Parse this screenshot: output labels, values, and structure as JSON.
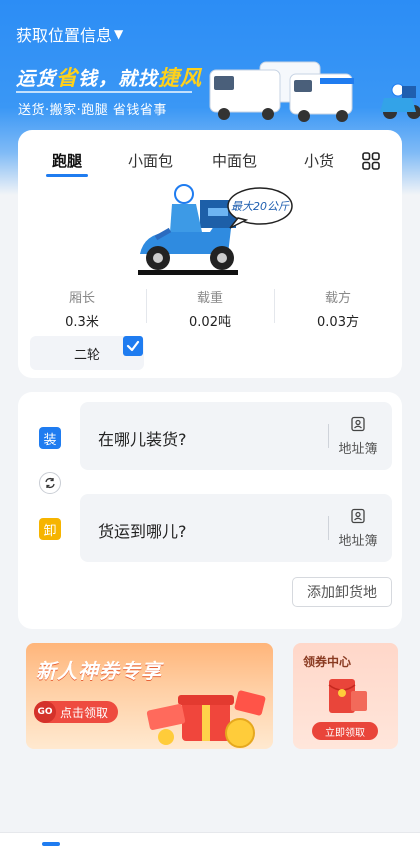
{
  "header": {
    "location_label": "获取位置信息",
    "slogan_parts": [
      "运货",
      "省",
      "钱，就找",
      "捷风"
    ],
    "sub_slogan": "送货·搬家·跑腿  省钱省事",
    "accent_color": "#1f7cf0"
  },
  "vehicle_tabs": [
    {
      "label": "跑腿",
      "active": true
    },
    {
      "label": "小面包",
      "active": false
    },
    {
      "label": "中面包",
      "active": false
    },
    {
      "label": "小货",
      "active": false
    }
  ],
  "vehicle": {
    "badge_text": "最大20公斤",
    "specs": [
      {
        "key": "厢长",
        "value": "0.3米"
      },
      {
        "key": "载重",
        "value": "0.02吨"
      },
      {
        "key": "载方",
        "value": "0.03方"
      }
    ],
    "wheel_option": "二轮",
    "wheel_checked": true
  },
  "address": {
    "load_tag": "装",
    "load_placeholder": "在哪儿装货?",
    "unload_tag": "卸",
    "unload_placeholder": "货运到哪儿?",
    "address_book_label": "地址簿",
    "add_unload_label": "添加卸货地"
  },
  "promos": {
    "big_title": "新人神券专享",
    "big_go": "GO",
    "big_button": "点击领取",
    "small_title": "领券中心",
    "small_button": "立即领取"
  }
}
